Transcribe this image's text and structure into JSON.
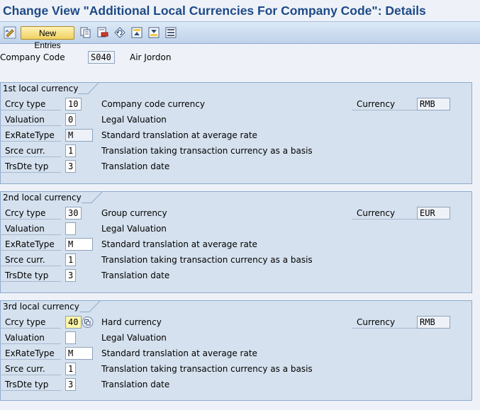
{
  "header": {
    "title": "Change View \"Additional Local Currencies For Company Code\": Details"
  },
  "toolbar": {
    "new_entries_label": "New Entries"
  },
  "company": {
    "label": "Company Code",
    "code": "S040",
    "name": "Air Jordon"
  },
  "groups": [
    {
      "title": "1st local currency",
      "rows": [
        {
          "label": "Crcy type",
          "value": "10",
          "desc": "Company code currency"
        },
        {
          "label": "Valuation",
          "value": "0",
          "desc": "Legal Valuation"
        },
        {
          "label": "ExRateType",
          "value": "M",
          "desc": "Standard translation at average rate"
        },
        {
          "label": "Srce curr.",
          "value": "1",
          "desc": "Translation taking transaction currency as a basis"
        },
        {
          "label": "TrsDte typ",
          "value": "3",
          "desc": "Translation date"
        }
      ],
      "currency_label": "Currency",
      "currency_value": "RMB"
    },
    {
      "title": "2nd local currency",
      "rows": [
        {
          "label": "Crcy type",
          "value": "30",
          "desc": "Group currency"
        },
        {
          "label": "Valuation",
          "value": "",
          "desc": "Legal Valuation"
        },
        {
          "label": "ExRateType",
          "value": "M",
          "desc": "Standard translation at average rate"
        },
        {
          "label": "Srce curr.",
          "value": "1",
          "desc": "Translation taking transaction currency as a basis"
        },
        {
          "label": "TrsDte typ",
          "value": "3",
          "desc": "Translation date"
        }
      ],
      "currency_label": "Currency",
      "currency_value": "EUR"
    },
    {
      "title": "3rd local currency",
      "rows": [
        {
          "label": "Crcy type",
          "value": "40",
          "desc": "Hard currency"
        },
        {
          "label": "Valuation",
          "value": "",
          "desc": "Legal Valuation"
        },
        {
          "label": "ExRateType",
          "value": "M",
          "desc": "Standard translation at average rate"
        },
        {
          "label": "Srce curr.",
          "value": "1",
          "desc": "Translation taking transaction currency as a basis"
        },
        {
          "label": "TrsDte typ",
          "value": "3",
          "desc": "Translation date"
        }
      ],
      "currency_label": "Currency",
      "currency_value": "RMB"
    }
  ],
  "icons": [
    "display-change-icon",
    "copy-icon",
    "delete-icon",
    "undo-icon",
    "previous-entry-icon",
    "next-entry-icon",
    "select-all-icon",
    "value-help-icon"
  ]
}
